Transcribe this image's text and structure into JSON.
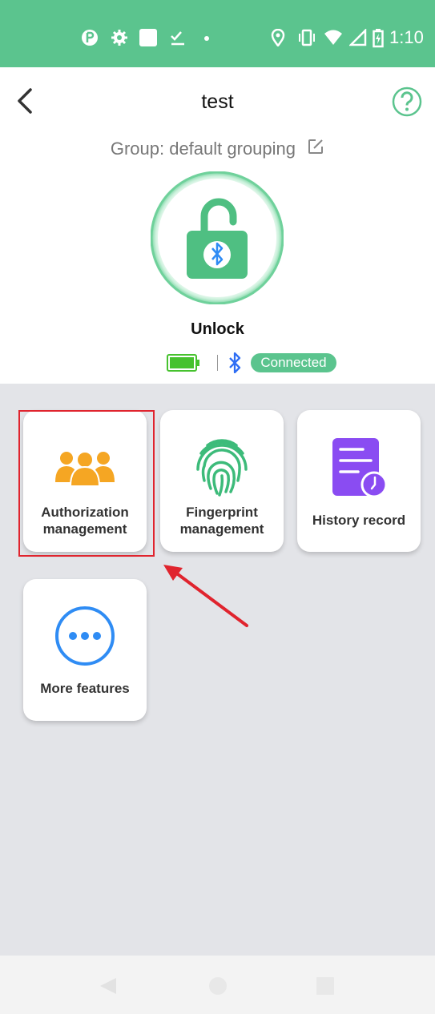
{
  "status_bar": {
    "time": "1:10",
    "icons": [
      "app-icon",
      "settings-icon",
      "square-icon",
      "checklist-icon",
      "dot-icon",
      "location-icon",
      "vibrate-icon",
      "wifi-icon",
      "signal-icon",
      "battery-charging-icon"
    ]
  },
  "header": {
    "title": "test",
    "group_label": "Group: default grouping",
    "unlock_label": "Unlock",
    "connection_status": "Connected"
  },
  "features": [
    {
      "label_line1": "Authorization",
      "label_line2": "management",
      "icon": "users-icon",
      "color": "#f5a623"
    },
    {
      "label_line1": "Fingerprint",
      "label_line2": "management",
      "icon": "fingerprint-icon",
      "color": "#3dbb7a"
    },
    {
      "label": "History record",
      "icon": "history-icon",
      "color": "#8a4cf2"
    },
    {
      "label": "More features",
      "icon": "more-icon",
      "color": "#2f8cf4"
    }
  ],
  "colors": {
    "accent": "#5bc48e",
    "highlight": "#e0242e",
    "background": "#e3e4e8"
  }
}
